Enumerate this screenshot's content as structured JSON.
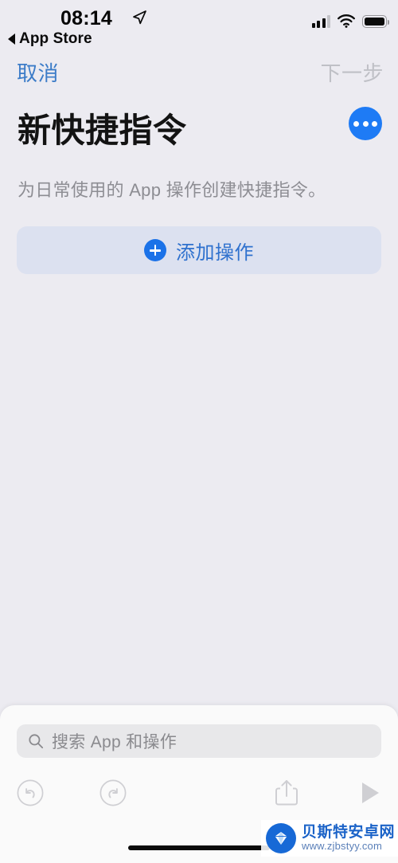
{
  "status_bar": {
    "time": "08:14",
    "back_label": "App Store",
    "location_icon": "location-arrow-icon",
    "signal_icon": "cellular-signal-icon",
    "wifi_icon": "wifi-icon",
    "battery_icon": "battery-full-icon"
  },
  "nav_bar": {
    "cancel_label": "取消",
    "next_label": "下一步",
    "cancel_color": "#3C7CC8",
    "next_color": "#BFC0C6"
  },
  "header": {
    "title": "新快捷指令",
    "subtitle": "为日常使用的 App 操作创建快捷指令。",
    "more_button_icon": "ellipsis-icon",
    "more_button_color": "#1E7BF5"
  },
  "add_action": {
    "label": "添加操作",
    "icon": "plus-circle-icon",
    "background": "#DCE1F0",
    "label_color": "#2F71CE"
  },
  "sheet": {
    "search": {
      "placeholder": "搜索 App 和操作",
      "value": "",
      "icon": "search-icon"
    },
    "toolbar": {
      "undo_icon": "undo-circle-icon",
      "redo_icon": "redo-circle-icon",
      "share_icon": "share-icon",
      "play_icon": "play-icon",
      "disabled_color": "#CFCFD3"
    }
  },
  "watermark": {
    "title": "贝斯特安卓网",
    "url": "www.zjbstyy.com",
    "logo_icon": "shell-logo-icon"
  },
  "theme": {
    "page_background": "#ECEBF1",
    "sheet_background": "#FAFAFA",
    "accent": "#1E7BF5"
  }
}
